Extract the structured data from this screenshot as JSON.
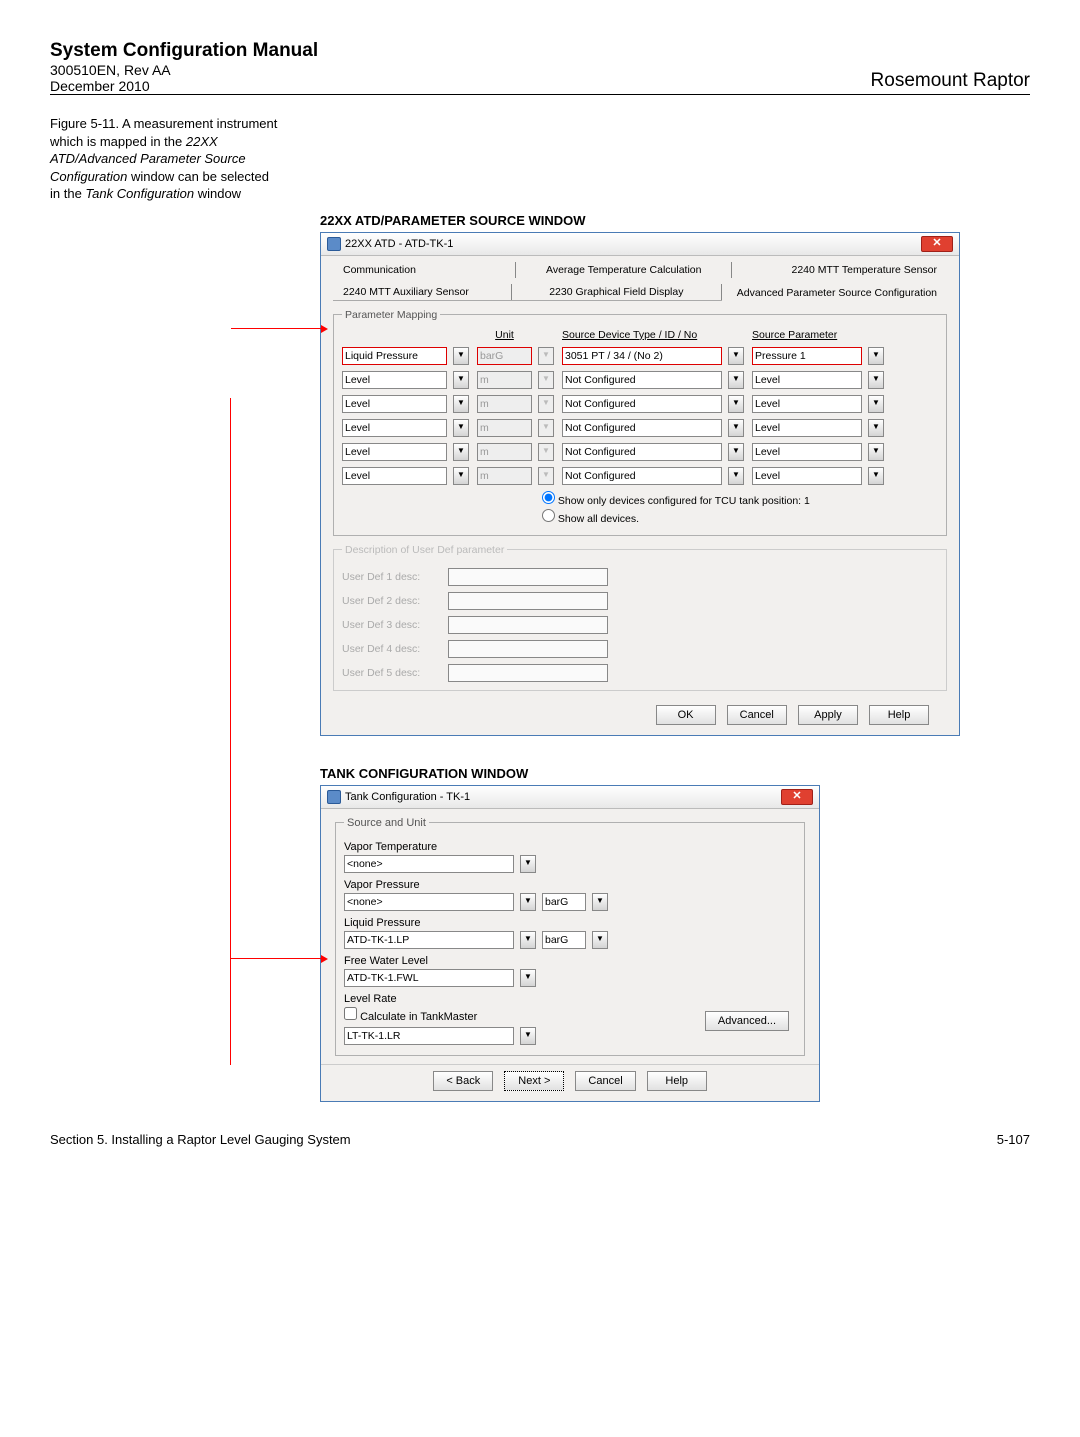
{
  "header": {
    "title": "System Configuration Manual",
    "doc_code": "300510EN, Rev AA",
    "doc_date": "December 2010",
    "product": "Rosemount Raptor"
  },
  "figure_caption": {
    "lead": "Figure 5-11. A measurement instrument which is mapped in the ",
    "ital1": "22XX ATD/Advanced Parameter Source Configuration",
    "mid": " window can be selected in the ",
    "ital2": "Tank Configuration",
    "tail": " window"
  },
  "sec1_title": "22XX ATD/PARAMETER SOURCE WINDOW",
  "win1": {
    "title": "22XX ATD  - ATD-TK-1",
    "tabs_row1": [
      "Communication",
      "Average Temperature Calculation",
      "2240 MTT Temperature Sensor"
    ],
    "tabs_row2": [
      "2240 MTT Auxiliary Sensor",
      "2230 Graphical Field Display",
      "Advanced Parameter Source Configuration"
    ],
    "groupbox": "Parameter Mapping",
    "head": {
      "c1": "",
      "c2": "Unit",
      "c3": "Source Device Type / ID / No",
      "c4": "Source Parameter"
    },
    "rows": [
      {
        "param": "Liquid Pressure",
        "unit": "barG",
        "source": "3051 PT / 34 / (No 2)",
        "sp": "Pressure 1",
        "unit_disabled": true,
        "highlight": true
      },
      {
        "param": "Level",
        "unit": "m",
        "source": "Not Configured",
        "sp": "Level",
        "unit_disabled": true,
        "highlight": false
      },
      {
        "param": "Level",
        "unit": "m",
        "source": "Not Configured",
        "sp": "Level",
        "unit_disabled": true,
        "highlight": false
      },
      {
        "param": "Level",
        "unit": "m",
        "source": "Not Configured",
        "sp": "Level",
        "unit_disabled": true,
        "highlight": false
      },
      {
        "param": "Level",
        "unit": "m",
        "source": "Not Configured",
        "sp": "Level",
        "unit_disabled": true,
        "highlight": false
      },
      {
        "param": "Level",
        "unit": "m",
        "source": "Not Configured",
        "sp": "Level",
        "unit_disabled": true,
        "highlight": false
      }
    ],
    "radio_opt1": "Show only devices configured for TCU tank position:   1",
    "radio_opt2": "Show all devices.",
    "userdef_legend": "Description of User Def parameter",
    "userdef_labels": [
      "User Def 1 desc:",
      "User Def 2 desc:",
      "User Def 3 desc:",
      "User Def 4 desc:",
      "User Def 5 desc:"
    ],
    "btns": {
      "ok": "OK",
      "cancel": "Cancel",
      "apply": "Apply",
      "help": "Help"
    }
  },
  "sec2_title": "TANK CONFIGURATION WINDOW",
  "win2": {
    "title": "Tank Configuration - TK-1",
    "group": "Source and Unit",
    "vapor_temp_label": "Vapor Temperature",
    "vapor_temp_val": "<none>",
    "vapor_press_label": "Vapor Pressure",
    "vapor_press_val": "<none>",
    "vapor_press_unit": "barG",
    "liquid_press_label": "Liquid Pressure",
    "liquid_press_val": "ATD-TK-1.LP",
    "liquid_press_unit": "barG",
    "fwl_label": "Free Water Level",
    "fwl_val": "ATD-TK-1.FWL",
    "levelrate_label": "Level Rate",
    "levelrate_cb": "Calculate in TankMaster",
    "levelrate_val": "LT-TK-1.LR",
    "adv_btn": "Advanced...",
    "btns": {
      "back": "< Back",
      "next": "Next >",
      "cancel": "Cancel",
      "help": "Help"
    }
  },
  "footer": {
    "section": "Section 5. Installing a Raptor Level Gauging System",
    "page": "5-107"
  }
}
